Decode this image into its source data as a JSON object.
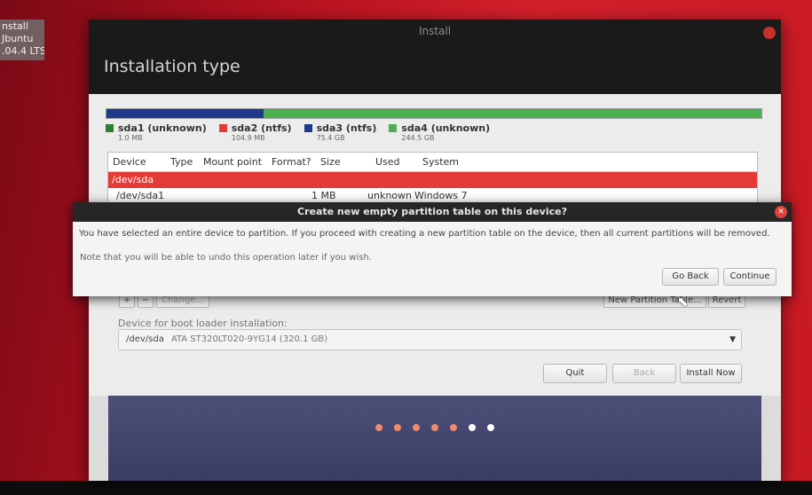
{
  "desktop": {
    "icon_label_lines": [
      "nstall",
      "Jbuntu",
      ".04.4 LTS"
    ],
    "accent_color": "#c81a24"
  },
  "window": {
    "title": "Install",
    "page_title": "Installation type"
  },
  "partitions": {
    "legend": [
      {
        "name": "sda1 (unknown)",
        "size": "1.0 MB",
        "color": "#2e7d32"
      },
      {
        "name": "sda2 (ntfs)",
        "size": "104.9 MB",
        "color": "#e53935"
      },
      {
        "name": "sda3 (ntfs)",
        "size": "75.4 GB",
        "color": "#1f3a8a"
      },
      {
        "name": "sda4 (unknown)",
        "size": "244.5 GB",
        "color": "#4caf50"
      }
    ],
    "columns": [
      "Device",
      "Type",
      "Mount point",
      "Format?",
      "Size",
      "Used",
      "System"
    ],
    "selected_row": "/dev/sda",
    "rows": [
      {
        "device": "/dev/sda1",
        "size": "1 MB",
        "used": "unknown",
        "system": "Windows 7"
      }
    ]
  },
  "dialog": {
    "title": "Create new empty partition table on this device?",
    "message": "You have selected an entire device to partition. If you proceed with creating a new partition table on the device, then all current partitions will be removed.",
    "note": "Note that you will be able to undo this operation later if you wish.",
    "go_back_label": "Go Back",
    "continue_label": "Continue"
  },
  "controls": {
    "add_label": "+",
    "remove_label": "−",
    "change_label": "Change...",
    "new_table_label": "New Partition Table...",
    "revert_label": "Revert",
    "boot_loader_label": "Device for boot loader installation:",
    "boot_device": "/dev/sda",
    "boot_device_desc": "ATA ST320LT020-9YG14 (320.1 GB)",
    "quit_label": "Quit",
    "back_label": "Back",
    "install_now_label": "Install Now"
  },
  "progress": {
    "total_steps": 7,
    "completed_steps": 5,
    "done_color": "#f08a6c",
    "pending_color": "#ffffff"
  }
}
